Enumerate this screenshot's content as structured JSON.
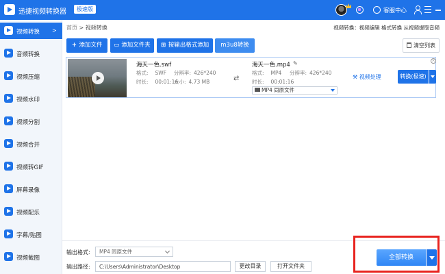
{
  "titlebar": {
    "app_title": "迅捷视频转换器",
    "badge": "极速版",
    "customer_service": "客服中心"
  },
  "sidebar": {
    "items": [
      {
        "label": "视频转换",
        "active": true
      },
      {
        "label": "音频转换"
      },
      {
        "label": "视频压缩"
      },
      {
        "label": "视频水印"
      },
      {
        "label": "视频分割"
      },
      {
        "label": "视频合并"
      },
      {
        "label": "视频转GIF"
      },
      {
        "label": "屏幕录像"
      },
      {
        "label": "视频配乐"
      },
      {
        "label": "字幕/贴图"
      },
      {
        "label": "视频截图"
      }
    ],
    "active_arrow": ">"
  },
  "main": {
    "breadcrumb_home": "首页",
    "breadcrumb_sep": ">",
    "breadcrumb_current": "视频转换",
    "hint": "视频转换：视频编辑 格式转换 从视频提取音频"
  },
  "toolbar": {
    "add_file": "添加文件",
    "add_folder": "添加文件夹",
    "add_by_format": "按输出格式添加",
    "m3u8": "m3u8转换",
    "clear_list": "清空列表"
  },
  "file": {
    "source_name": "海天一色.swf",
    "format_label": "格式:",
    "source_format": "SWF",
    "resolution_label": "分辨率:",
    "source_resolution": "426*240",
    "duration_label": "时长:",
    "source_duration": "00:01:16",
    "size_label": "大小:",
    "source_size": "4.73 MB",
    "target_name": "海天一色.mp4",
    "target_format": "MP4",
    "target_resolution": "426*240",
    "target_duration": "00:01:16",
    "output_select": "MP4  同原文件",
    "video_process": "视频处理",
    "convert_button": "转换(极速)",
    "close": "×"
  },
  "bottom": {
    "output_format_label": "输出格式:",
    "output_format_value": "MP4  同原文件",
    "output_path_label": "输出路径:",
    "output_path_value": "C:\\Users\\Administrator\\Desktop",
    "change_dir": "更改目录",
    "open_folder": "打开文件夹",
    "convert_all": "全部转换"
  },
  "colors": {
    "brand_blue": "#1f73e8",
    "highlight_red": "#e8231f",
    "card_border": "#a9c8f4",
    "sidebar_bg": "#f2f6fb"
  },
  "icons": [
    "logo-icon",
    "avatar",
    "crown-icon",
    "vip-icon",
    "headset-icon",
    "user-icon",
    "menu-icon",
    "minimize-icon",
    "video-icon",
    "plus-icon",
    "folder-icon",
    "format-add-icon",
    "trash-icon",
    "play-icon",
    "shuffle-icon",
    "pencil-icon",
    "film-icon",
    "magic-icon",
    "chevron-down-icon"
  ]
}
